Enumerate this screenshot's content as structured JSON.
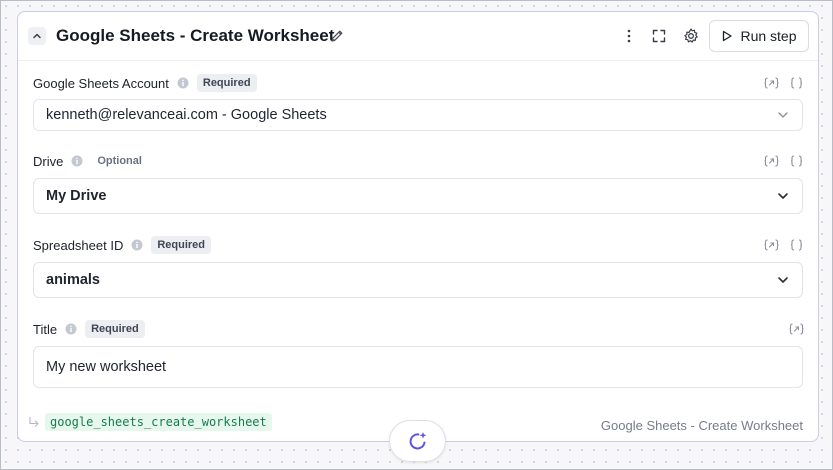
{
  "card": {
    "title": "Google Sheets - Create Worksheet",
    "run_label": "Run step",
    "footer_code": "google_sheets_create_worksheet",
    "footer_title": "Google Sheets - Create Worksheet"
  },
  "fields": {
    "account": {
      "label": "Google Sheets Account",
      "badge": "Required",
      "value": "kenneth@relevanceai.com - Google Sheets"
    },
    "drive": {
      "label": "Drive",
      "badge": "Optional",
      "value": "My Drive"
    },
    "spreadsheet": {
      "label": "Spreadsheet ID",
      "badge": "Required",
      "value": "animals"
    },
    "title": {
      "label": "Title",
      "badge": "Required",
      "value": "My new worksheet"
    }
  },
  "colors": {
    "accent": "#5b54e0",
    "code_bg": "#e6f7ee",
    "code_text": "#1a7a4e"
  },
  "icons": [
    "chevron-up-icon",
    "pencil-icon",
    "kebab-icon",
    "expand-icon",
    "gear-icon",
    "play-icon",
    "info-icon",
    "variable-link-icon",
    "json-braces-icon",
    "chevron-down-icon",
    "return-arrow-icon",
    "ai-refresh-sparkle-icon"
  ]
}
